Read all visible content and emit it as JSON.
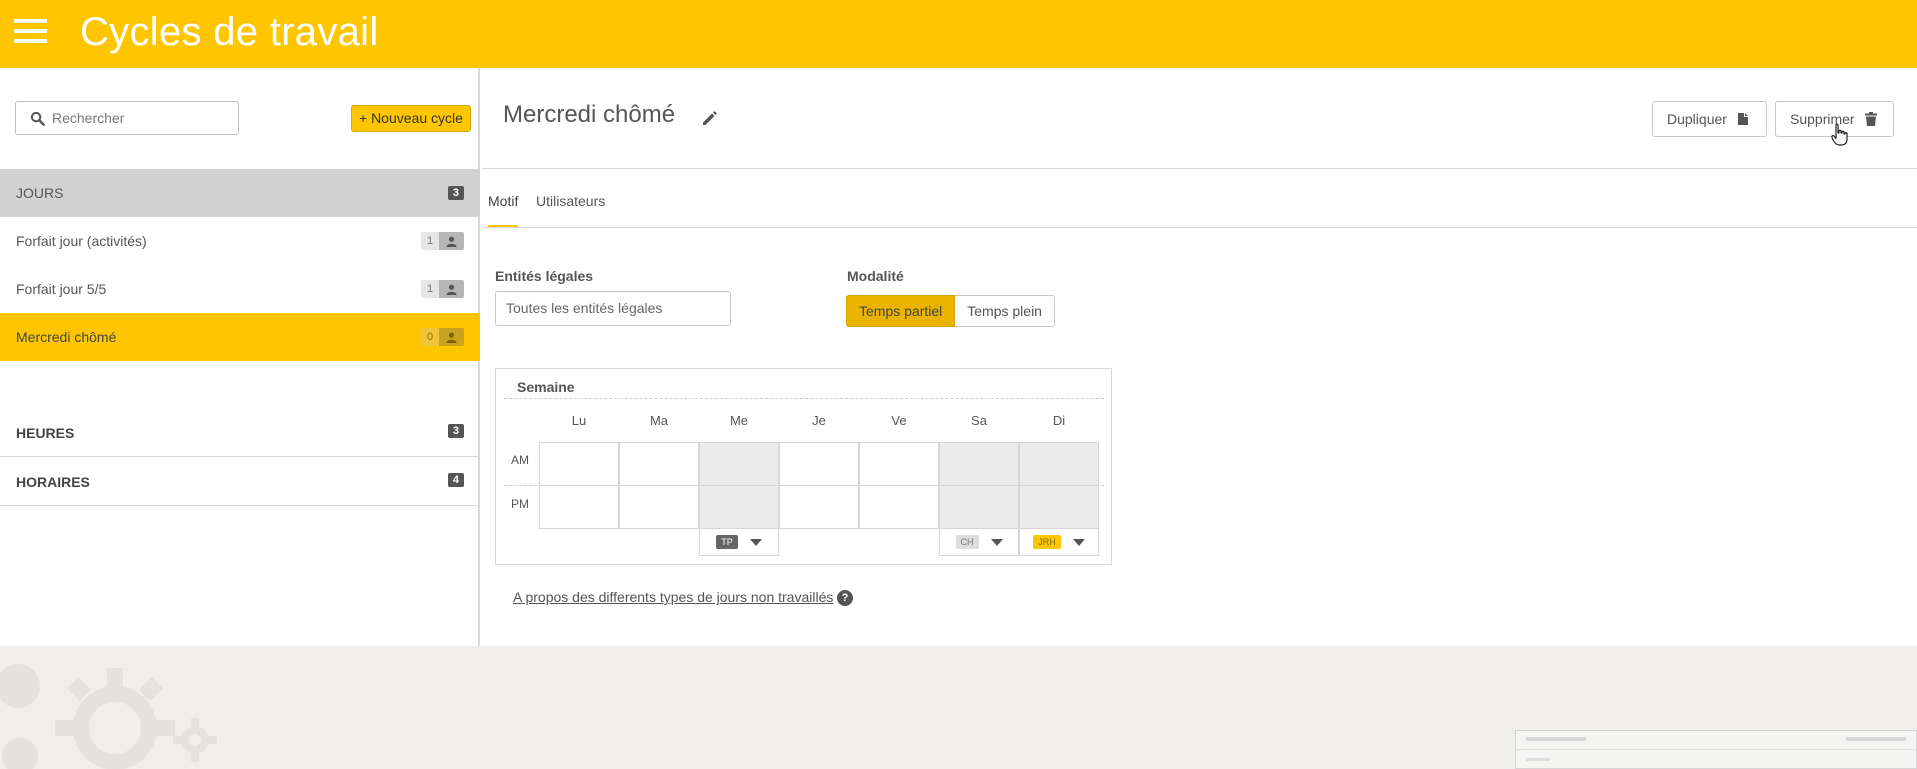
{
  "header": {
    "title": "Cycles de travail"
  },
  "sidebar": {
    "search_placeholder": "Rechercher",
    "new_cycle_label": "+ Nouveau cycle",
    "groups": [
      {
        "label": "Jours",
        "count": "3"
      },
      {
        "label": "HEURES",
        "count": "3"
      },
      {
        "label": "HORAIRES",
        "count": "4"
      }
    ],
    "items": [
      {
        "label": "Forfait jour (activités)",
        "users": "1"
      },
      {
        "label": "Forfait jour 5/5",
        "users": "1"
      },
      {
        "label": "Mercredi chômé",
        "users": "0",
        "selected": true
      }
    ]
  },
  "main": {
    "title": "Mercredi chômé",
    "duplicate_label": "Dupliquer",
    "delete_label": "Supprimer",
    "tabs": [
      {
        "label": "Motif",
        "active": true
      },
      {
        "label": "Utilisateurs"
      }
    ],
    "entites_label": "Entités légales",
    "entites_value": "Toutes les entités légales",
    "modalite_label": "Modalité",
    "modalite_options": [
      {
        "label": "Temps partiel",
        "active": true
      },
      {
        "label": "Temps plein"
      }
    ],
    "week": {
      "title": "Semaine",
      "days": [
        "Lu",
        "Ma",
        "Me",
        "Je",
        "Ve",
        "Sa",
        "Di"
      ],
      "am_label": "AM",
      "pm_label": "PM",
      "off_days": [
        "Me",
        "Sa",
        "Di"
      ],
      "dayoff_tags": {
        "Me": "TP",
        "Sa": "CH",
        "Di": "JRH"
      }
    },
    "about_link": "A propos des differents types de jours non travaillés",
    "help_glyph": "?"
  },
  "colors": {
    "accent": "#fdc600",
    "accent_dark": "#e9b300",
    "page_bg": "#efeeec"
  }
}
